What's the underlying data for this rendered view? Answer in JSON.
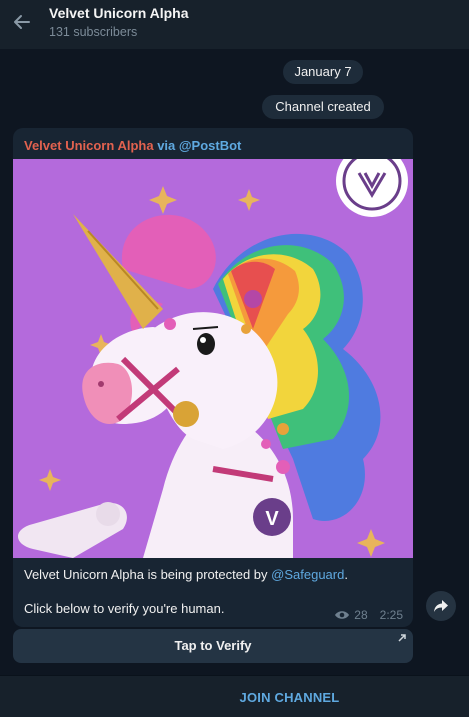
{
  "header": {
    "title": "Velvet Unicorn Alpha",
    "subtitle": "131 subscribers"
  },
  "service": {
    "date": "January 7",
    "created": "Channel created"
  },
  "message": {
    "author": "Velvet Unicorn Alpha",
    "via": "via @PostBot",
    "text_prefix": "Velvet Unicorn Alpha is being protected by ",
    "mention": "@Safeguard",
    "text_suffix": ".",
    "text_line2": "Click below to verify you're human.",
    "views": "28",
    "time": "2:25",
    "image_icon": "unicorn-illustration"
  },
  "button": {
    "label": "Tap to Verify"
  },
  "footer": {
    "join_label": "JOIN CHANNEL"
  },
  "colors": {
    "background": "#0e1621",
    "header": "#17212b",
    "bubble": "#182533",
    "author": "#e2624f",
    "accent": "#5fa9e0",
    "image_bg": "#b46adc"
  }
}
